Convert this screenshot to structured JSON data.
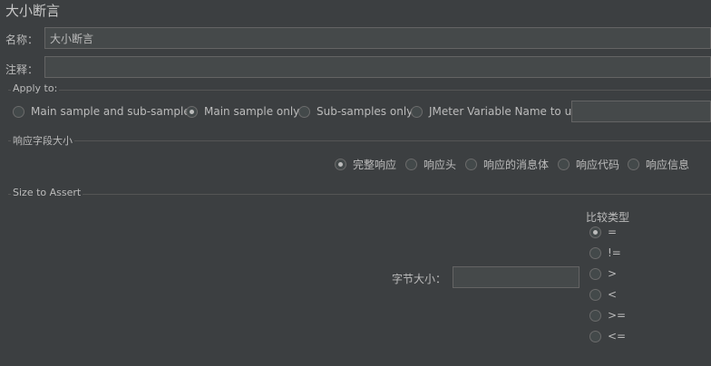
{
  "window": {
    "title": "大小断言"
  },
  "name_row": {
    "label": "名称：",
    "value": "大小断言"
  },
  "comment_row": {
    "label": "注释：",
    "value": ""
  },
  "apply_to": {
    "title": "Apply to:",
    "options": [
      {
        "label": "Main sample and sub-samples",
        "selected": false
      },
      {
        "label": "Main sample only",
        "selected": true
      },
      {
        "label": "Sub-samples only",
        "selected": false
      },
      {
        "label": "JMeter Variable Name to use",
        "selected": false
      }
    ],
    "variable_value": ""
  },
  "response_field": {
    "title": "响应字段大小",
    "options": [
      {
        "label": "完整响应",
        "selected": true
      },
      {
        "label": "响应头",
        "selected": false
      },
      {
        "label": "响应的消息体",
        "selected": false
      },
      {
        "label": "响应代码",
        "selected": false
      },
      {
        "label": "响应信息",
        "selected": false
      }
    ]
  },
  "size_to_assert": {
    "title": "Size to Assert",
    "size_label": "字节大小：",
    "size_value": "",
    "comparison_title": "比较类型",
    "comparisons": [
      {
        "label": "=",
        "selected": true
      },
      {
        "label": "!=",
        "selected": false
      },
      {
        "label": ">",
        "selected": false
      },
      {
        "label": "<",
        "selected": false
      },
      {
        "label": ">=",
        "selected": false
      },
      {
        "label": "<=",
        "selected": false
      }
    ]
  }
}
